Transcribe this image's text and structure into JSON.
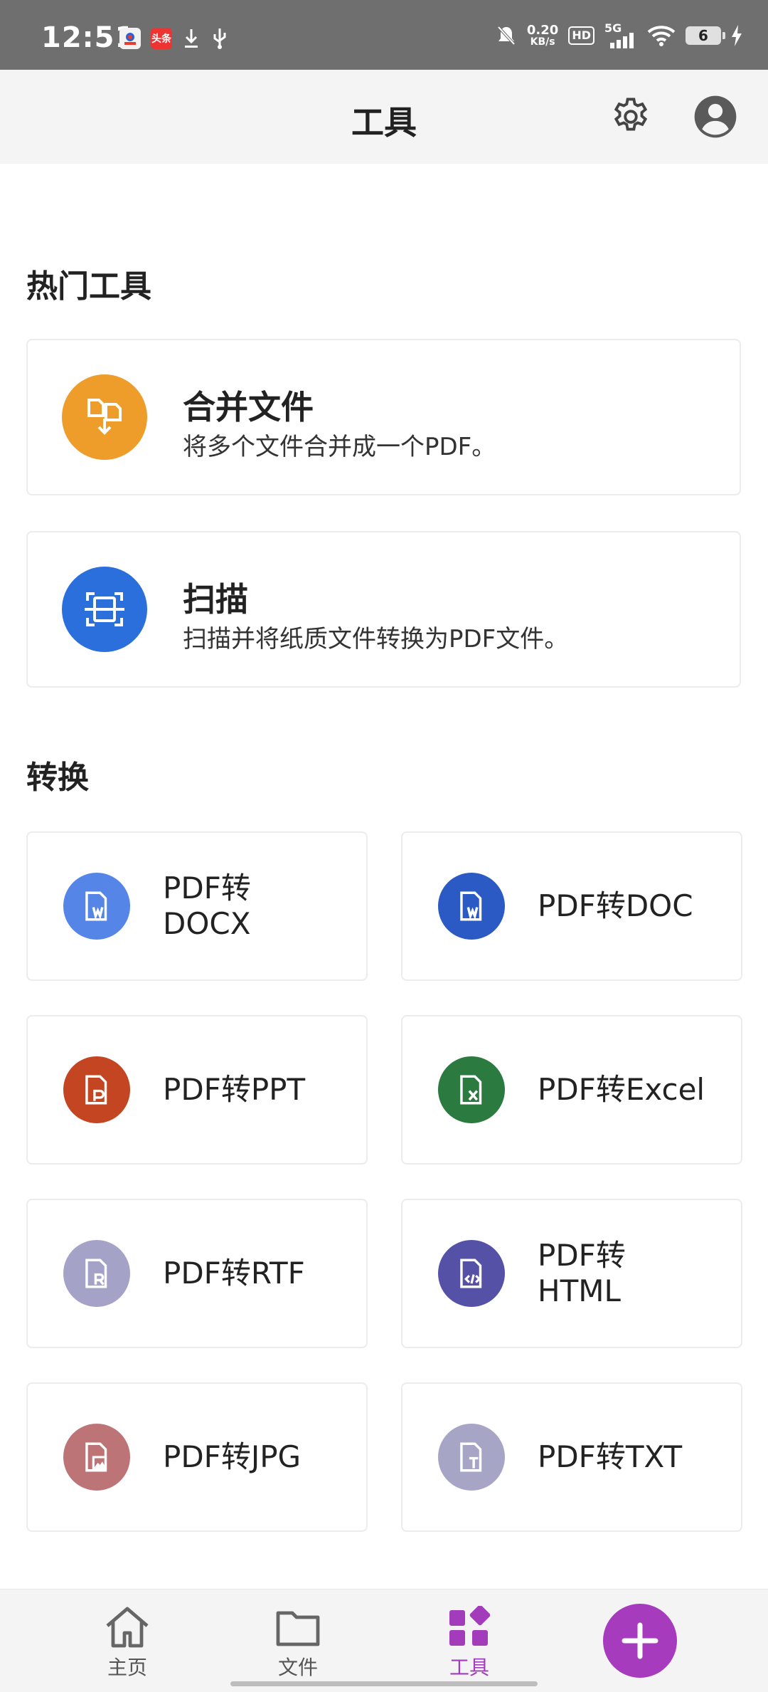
{
  "status_bar": {
    "time": "12:51",
    "app_icon_2": "头条",
    "net_speed_value": "0.20",
    "net_speed_unit": "KB/s",
    "hd_badge": "HD",
    "network": "5G",
    "battery": "6"
  },
  "header": {
    "title": "工具"
  },
  "sections": {
    "hot_title": "热门工具",
    "convert_title": "转换"
  },
  "hot_tools": [
    {
      "title": "合并文件",
      "desc": "将多个文件合并成一个PDF。",
      "color": "#ee9d2b"
    },
    {
      "title": "扫描",
      "desc": "扫描并将纸质文件转换为PDF文件。",
      "color": "#2b6fdd"
    }
  ],
  "convert_tools": [
    {
      "label": "PDF转DOCX",
      "line1": "PDF转",
      "line2": "DOCX",
      "color": "#5585e6"
    },
    {
      "label": "PDF转DOC",
      "color": "#2b5ac4"
    },
    {
      "label": "PDF转PPT",
      "color": "#c34521"
    },
    {
      "label": "PDF转Excel",
      "color": "#2b7a3f"
    },
    {
      "label": "PDF转RTF",
      "color": "#a4a3c7"
    },
    {
      "label": "PDF转HTML",
      "line1": "PDF转",
      "line2": "HTML",
      "color": "#5551a6"
    },
    {
      "label": "PDF转JPG",
      "color": "#bd7477"
    },
    {
      "label": "PDF转TXT",
      "color": "#a6a5c6"
    }
  ],
  "bottom_nav": {
    "home": "主页",
    "files": "文件",
    "tools": "工具",
    "active_color": "#a23cba",
    "fab_color": "#a63bbd"
  }
}
